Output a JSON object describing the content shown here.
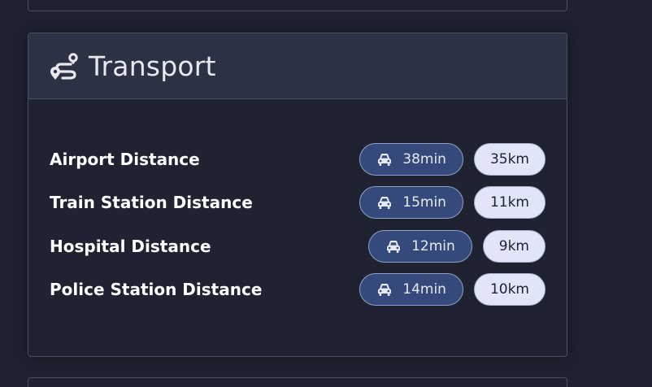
{
  "card": {
    "title": "Transport",
    "icon": "route-icon"
  },
  "rows": [
    {
      "label": "Airport Distance",
      "time": "38min",
      "distance": "35km",
      "icon": "car-icon"
    },
    {
      "label": "Train Station Distance",
      "time": "15min",
      "distance": "11km",
      "icon": "car-icon"
    },
    {
      "label": "Hospital Distance",
      "time": "12min",
      "distance": "9km",
      "icon": "car-icon"
    },
    {
      "label": "Police Station Distance",
      "time": "14min",
      "distance": "10km",
      "icon": "car-icon"
    }
  ],
  "colors": {
    "background": "#1e2130",
    "header": "#2c3143",
    "time_pill": "#354a7a",
    "distance_pill": "#e2e5f7"
  }
}
